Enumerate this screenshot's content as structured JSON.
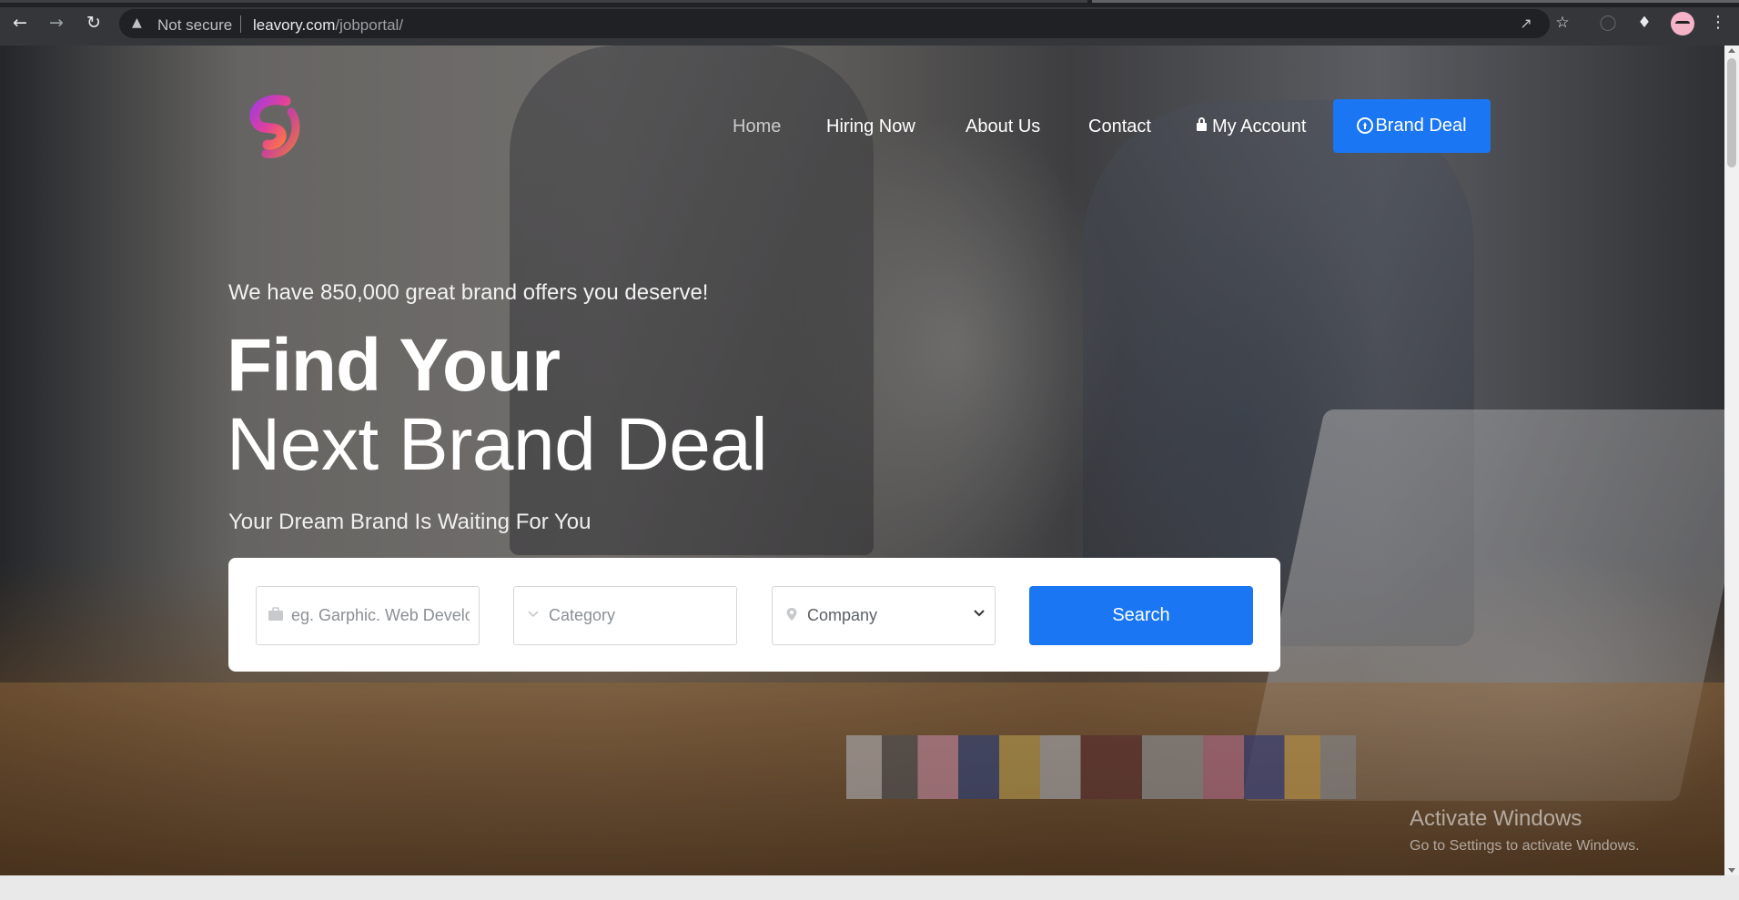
{
  "browser": {
    "security_label": "Not secure",
    "url_host": "leavory.com",
    "url_path": "/jobportal/",
    "icons": [
      "back-icon",
      "forward-icon",
      "reload-icon",
      "warning-icon",
      "share-icon",
      "star-icon",
      "extension-icon",
      "puzzle-icon",
      "avatar",
      "menu-dots-icon"
    ]
  },
  "nav": {
    "items": [
      {
        "label": "Home",
        "active": true
      },
      {
        "label": "Hiring Now"
      },
      {
        "label": "About Us"
      },
      {
        "label": "Contact"
      },
      {
        "label": "My Account"
      }
    ],
    "cta_label": "Brand Deal"
  },
  "hero": {
    "tagline": "We have 850,000 great brand offers you deserve!",
    "headline_bold": "Find Your",
    "headline_light": "Next Brand Deal",
    "subheadline": "Your Dream Brand Is Waiting For You"
  },
  "search": {
    "keyword_placeholder": "eg. Garphic. Web Develo",
    "category_placeholder": "Category",
    "company_selected": "Company",
    "button_label": "Search"
  },
  "os_watermark": {
    "line1": "Activate Windows",
    "line2": "Go to Settings to activate Windows."
  },
  "colors": {
    "accent": "#1a76f2",
    "chrome_bg": "#35363a",
    "omnibox_bg": "#202124"
  }
}
